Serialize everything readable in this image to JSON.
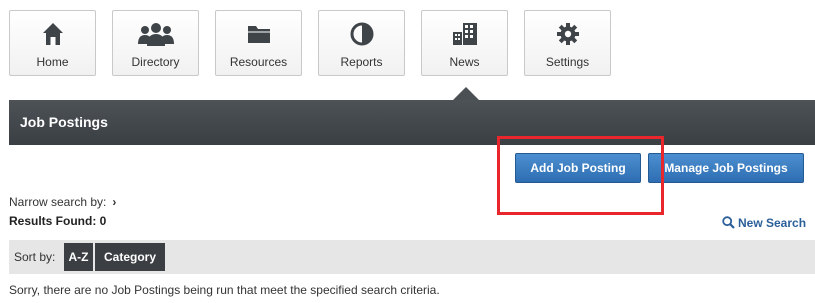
{
  "nav": {
    "items": [
      {
        "label": "Home",
        "icon": "home-icon"
      },
      {
        "label": "Directory",
        "icon": "people-icon"
      },
      {
        "label": "Resources",
        "icon": "folder-icon"
      },
      {
        "label": "Reports",
        "icon": "pie-chart-icon"
      },
      {
        "label": "News",
        "icon": "building-icon"
      },
      {
        "label": "Settings",
        "icon": "gear-icon"
      }
    ],
    "active": "News"
  },
  "page": {
    "title": "Job Postings"
  },
  "actions": {
    "add_label": "Add Job Posting",
    "manage_label": "Manage Job Postings"
  },
  "search": {
    "narrow_label": "Narrow search by:",
    "narrow_chevron": "›",
    "results_label": "Results Found: 0",
    "new_search_label": "New Search"
  },
  "sort": {
    "label": "Sort by:",
    "options": [
      "A-Z",
      "Category"
    ]
  },
  "empty_message": "Sorry, there are no Job Postings being run that meet the specified search criteria.",
  "colors": {
    "header_bar": "#41464b",
    "button_blue": "#3b7cc0",
    "highlight_red": "#e8262b",
    "link_blue": "#2b5f99"
  }
}
